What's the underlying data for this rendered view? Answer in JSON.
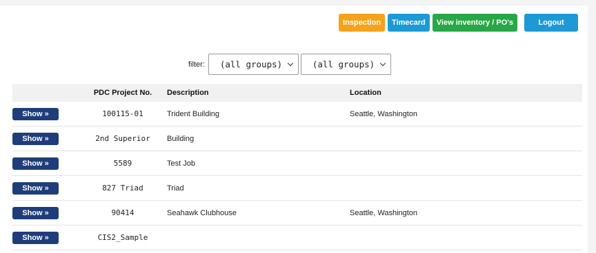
{
  "toolbar": {
    "inspection": "Inspection",
    "timecard": "Timecard",
    "inventory": "View inventory / PO's",
    "logout": "Logout"
  },
  "filter": {
    "label": "filter:",
    "select1": "(all groups)",
    "select2": "(all groups)"
  },
  "table": {
    "headers": {
      "show": "",
      "project": "PDC Project No.",
      "description": "Description",
      "location": "Location"
    },
    "show_label": "Show »",
    "rows": [
      {
        "project": "100115-01",
        "description": "Trident Building",
        "location": "Seattle, Washington"
      },
      {
        "project": "2nd Superior",
        "description": "Building",
        "location": ""
      },
      {
        "project": "5589",
        "description": "Test Job",
        "location": ""
      },
      {
        "project": "827 Triad",
        "description": "Triad",
        "location": ""
      },
      {
        "project": "90414",
        "description": "Seahawk Clubhouse",
        "location": "Seattle, Washington"
      },
      {
        "project": "CIS2_Sample",
        "description": "",
        "location": ""
      }
    ]
  },
  "colors": {
    "inspection": "#f5a31a",
    "timecard": "#1d9ad6",
    "inventory": "#27a745",
    "logout": "#1d9ad6",
    "show_button": "#1f3d7a"
  }
}
